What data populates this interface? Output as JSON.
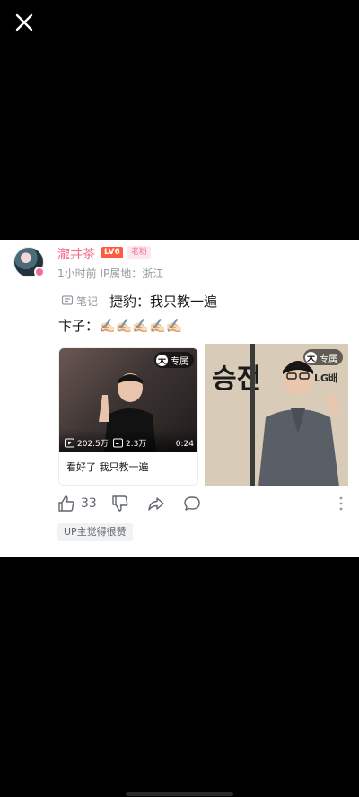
{
  "viewer": {
    "close_icon": "close-icon"
  },
  "post": {
    "author": {
      "name": "瀧井茶",
      "level": "LV6",
      "fan_badge": "老粉",
      "avatar_icon": "avatar"
    },
    "meta": "1小时前  IP属地：浙江",
    "note_tag": "笔记",
    "text_line1": "捷豹：我只教一遍",
    "text_line2": "卞子：✍🏻✍🏻✍🏻✍🏻✍🏻",
    "video": {
      "exclusive": "专属",
      "exclusive_prefix": "大",
      "views": "202.5万",
      "danmaku": "2.3万",
      "duration": "0:24",
      "title": "看好了 我只教一遍"
    },
    "photo": {
      "exclusive": "专属",
      "exclusive_prefix": "大",
      "sign_text": "승전",
      "sign_text2": "LG배"
    },
    "actions": {
      "like_count": "33"
    },
    "tag": "UP主觉得很赞"
  },
  "colors": {
    "accent_pink": "#f26b8a",
    "level_red": "#ff5a3c",
    "text_dark": "#18191c",
    "text_gray": "#9499a0"
  }
}
